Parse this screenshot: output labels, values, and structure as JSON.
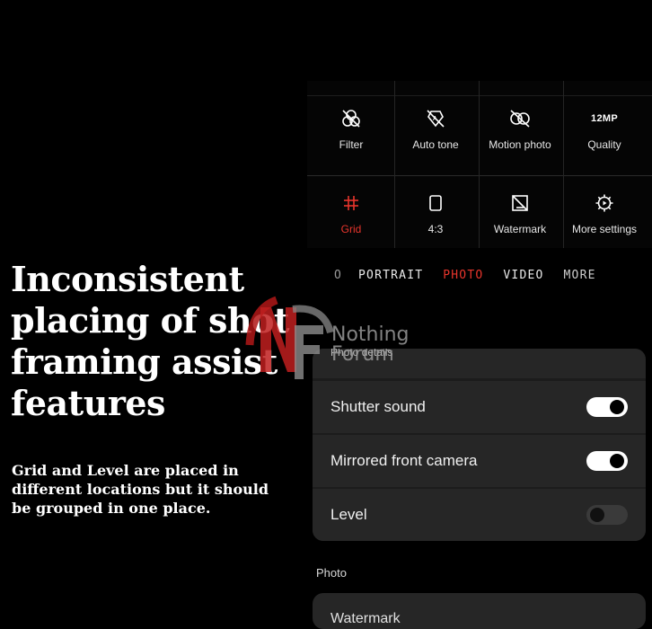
{
  "headline": "Inconsistent placing of shot framing assist features",
  "subtext": "Grid and Level are placed in different locations but it should be grouped in one place.",
  "quick_settings": [
    {
      "label": "Filter",
      "icon": "filter-icon",
      "active": false
    },
    {
      "label": "Auto tone",
      "icon": "auto-tone-icon",
      "active": false
    },
    {
      "label": "Motion photo",
      "icon": "motion-photo-icon",
      "active": false
    },
    {
      "label": "Quality",
      "icon": "quality-icon",
      "icon_text": "12MP",
      "active": false
    },
    {
      "label": "Grid",
      "icon": "grid-icon",
      "active": true
    },
    {
      "label": "4:3",
      "icon": "aspect-ratio-icon",
      "active": false
    },
    {
      "label": "Watermark",
      "icon": "watermark-icon",
      "active": false
    },
    {
      "label": "More settings",
      "icon": "more-settings-icon",
      "active": false
    }
  ],
  "modes": {
    "cut_left": "O",
    "items": [
      "PORTRAIT",
      "PHOTO",
      "VIDEO",
      "MORE"
    ],
    "active": "PHOTO"
  },
  "settings": {
    "cut_item": "Photo details",
    "items": [
      {
        "label": "Shutter sound",
        "on": true
      },
      {
        "label": "Mirrored front camera",
        "on": true
      },
      {
        "label": "Level",
        "on": false
      }
    ]
  },
  "photo_section": {
    "title": "Photo",
    "first_item": "Watermark"
  },
  "watermark": {
    "text_line1": "Nothing",
    "text_line2": "Forum"
  },
  "colors": {
    "accent": "#e8352c",
    "background": "#000000",
    "card": "#262626"
  }
}
